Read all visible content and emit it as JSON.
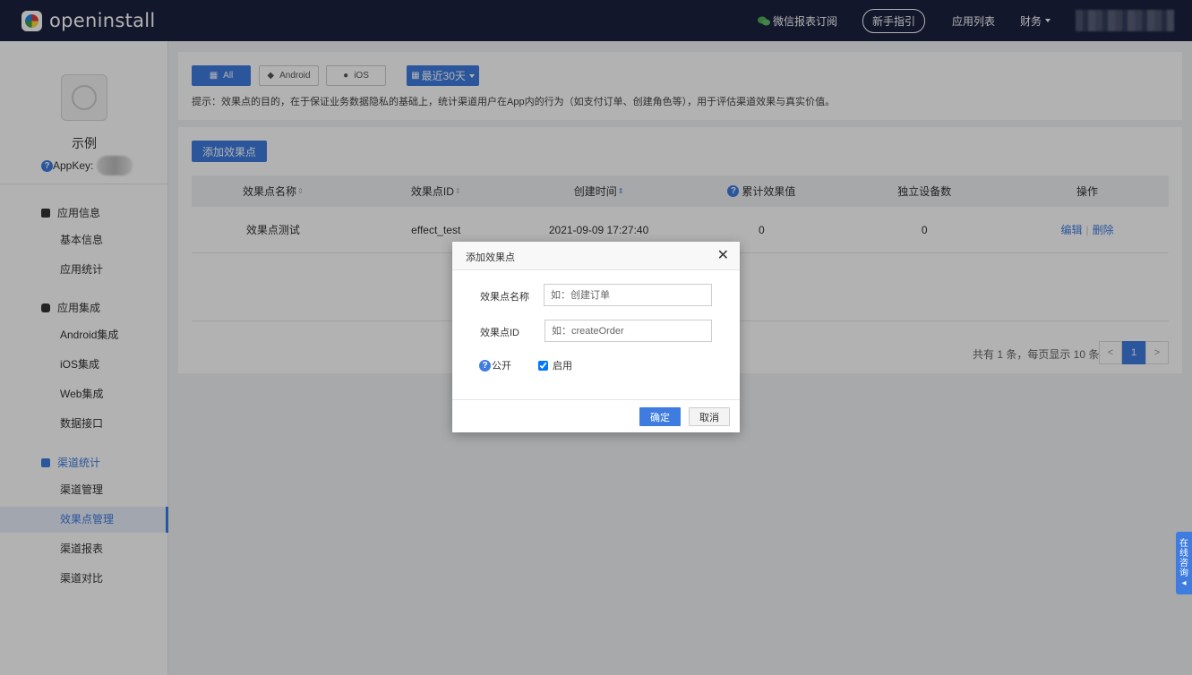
{
  "header": {
    "logo_text": "openinstall",
    "wechat_subscribe": "微信报表订阅",
    "guide": "新手指引",
    "app_list": "应用列表",
    "finance": "财务"
  },
  "sidebar": {
    "app_name": "示例",
    "appkey_label": "AppKey:",
    "groups": [
      {
        "label": "应用信息",
        "items": [
          "基本信息",
          "应用统计"
        ]
      },
      {
        "label": "应用集成",
        "items": [
          "Android集成",
          "iOS集成",
          "Web集成",
          "数据接口"
        ]
      },
      {
        "label": "渠道统计",
        "items": [
          "渠道管理",
          "效果点管理",
          "渠道报表",
          "渠道对比"
        ]
      }
    ],
    "active_item": "效果点管理"
  },
  "filters": {
    "all": "All",
    "android": "Android",
    "ios": "iOS",
    "date_range": "最近30天"
  },
  "hint": "提示：效果点的目的，在于保证业务数据隐私的基础上，统计渠道用户在App内的行为（如支付订单、创建角色等），用于评估渠道效果与真实价值。",
  "main": {
    "add_button": "添加效果点",
    "columns": [
      "效果点名称",
      "效果点ID",
      "创建时间",
      "累计效果值",
      "独立设备数",
      "操作"
    ],
    "rows": [
      {
        "name": "效果点测试",
        "id": "effect_test",
        "created": "2021-09-09 17:27:40",
        "total": "0",
        "devices": "0",
        "edit": "编辑",
        "delete": "删除"
      }
    ],
    "pager_text": "共有 1 条，每页显示 10 条",
    "pager": {
      "prev": "<",
      "current": "1",
      "next": ">"
    }
  },
  "modal": {
    "title": "添加效果点",
    "name_label": "效果点名称",
    "name_placeholder": "如：创建订单",
    "id_label": "效果点ID",
    "id_placeholder": "如：createOrder",
    "public_label": "公开",
    "enable_label": "启用",
    "enable_checked": true,
    "ok": "确定",
    "cancel": "取消"
  },
  "consult": [
    "在",
    "线",
    "咨",
    "询",
    "◂"
  ],
  "colors": {
    "accent": "#3e7ce0",
    "topbar": "#1a2240"
  }
}
